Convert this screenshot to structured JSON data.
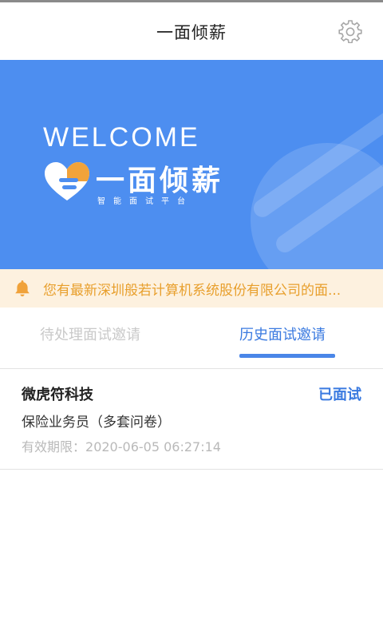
{
  "header": {
    "title": "一面倾薪"
  },
  "banner": {
    "welcome": "WELCOME",
    "brand": "一面倾薪",
    "subtitle": "智能面试平台"
  },
  "notice": {
    "text": "您有最新深圳般若计算机系统股份有限公司的面..."
  },
  "tabs": [
    {
      "label": "待处理面试邀请",
      "active": false
    },
    {
      "label": "历史面试邀请",
      "active": true
    }
  ],
  "records": [
    {
      "company": "微虎符科技",
      "status": "已面试",
      "position": "保险业务员（多套问卷）",
      "validity_label": "有效期限：",
      "validity_value": "2020-06-05 06:27:14"
    }
  ],
  "colors": {
    "primary_blue": "#4d8ef0",
    "tab_active": "#3a7ae0",
    "notice_bg": "#fdf1df",
    "notice_text": "#e89f2c",
    "logo_orange": "#f2a33a"
  },
  "icons": {
    "settings": "gear-icon",
    "notice": "bell-icon",
    "logo": "heart-logo-icon"
  }
}
